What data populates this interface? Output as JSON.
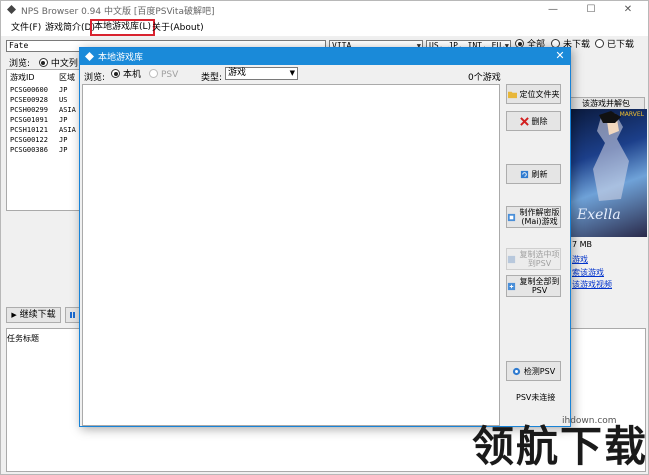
{
  "window": {
    "title": "NPS Browser 0.94 中文版 [百度PSVita破解吧]",
    "controls": {
      "minimize": "—",
      "maximize": "☐",
      "close": "✕"
    }
  },
  "menu": {
    "file": "文件(F)",
    "intro": "游戏简介(D)",
    "local_library": "本地游戏库(L)",
    "about": "关于(About)"
  },
  "search": {
    "value": "Fate"
  },
  "filters": {
    "platform": "VITA",
    "regions": "US, JP, INT, EU, AS",
    "status_options": [
      {
        "label": "全部",
        "selected": true
      },
      {
        "label": "未下载",
        "selected": false
      },
      {
        "label": "已下载",
        "selected": false
      }
    ]
  },
  "browse": {
    "label": "浏览:",
    "option": "中文列"
  },
  "game_list": {
    "headers": [
      "游戏ID",
      "区域"
    ],
    "rows": [
      {
        "id": "PCSG00600",
        "region": "JP"
      },
      {
        "id": "PCSE00928",
        "region": "US"
      },
      {
        "id": "PCSH00299",
        "region": "ASIA"
      },
      {
        "id": "PCSG01091",
        "region": "JP"
      },
      {
        "id": "PCSH10121",
        "region": "ASIA"
      },
      {
        "id": "PCSG00122",
        "region": "JP"
      },
      {
        "id": "PCSG00386",
        "region": "JP"
      }
    ]
  },
  "right_panel": {
    "download_button": "该游戏并解包",
    "cover_tag": "MARVEL",
    "cover_logo": "Exella",
    "size": "7 MB",
    "links": [
      "游戏",
      "索该游戏",
      "该游戏视频"
    ]
  },
  "downloads": {
    "continue_button": "继续下载",
    "task_title": "任务标题"
  },
  "dialog": {
    "title": "本地游戏库",
    "close": "✕",
    "browse_label": "浏览:",
    "browse_options": [
      {
        "label": "本机",
        "selected": true,
        "disabled": false
      },
      {
        "label": "PSV",
        "selected": false,
        "disabled": true
      }
    ],
    "type_label": "类型:",
    "type_value": "游戏",
    "game_count": "0个游戏",
    "buttons": {
      "locate_folder": "定位文件夹",
      "delete": "删除",
      "refresh": "刷新",
      "make_maidump": "制作解密版(Mai)游戏",
      "copy_selected": "复制选中项到PSV",
      "copy_all": "复制全部到PSV",
      "detect_psv": "检测PSV"
    },
    "status": "PSV未连接"
  },
  "watermark": {
    "url": "ihdown.com",
    "text": "领航下载"
  },
  "colors": {
    "dialog_title": "#1a8ad9",
    "highlight_border": "#d9232f",
    "link": "#0033cc"
  }
}
